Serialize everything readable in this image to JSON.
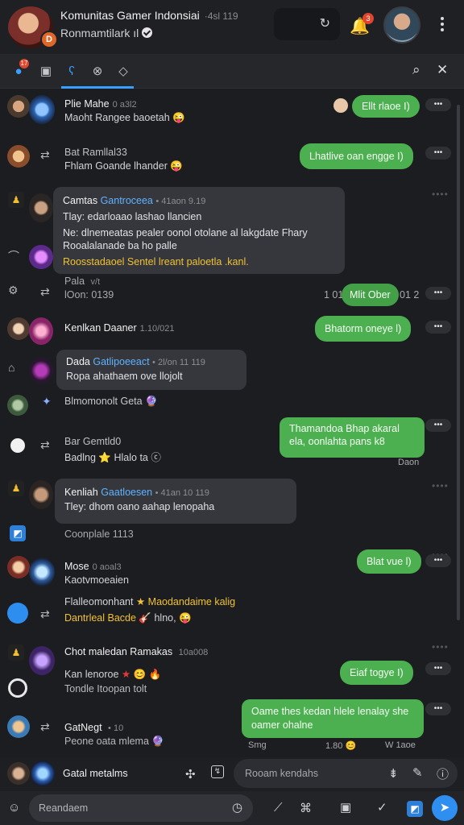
{
  "header": {
    "group_title": "Komunitas Gamer Indonsiai",
    "group_meta": "·4sl 119",
    "subtitle": "Ronmamtilark ıl",
    "group_badge": "D",
    "bell_count": "3",
    "icons": [
      "refresh-icon",
      "bell-icon",
      "kebab-menu-icon"
    ]
  },
  "tabs": {
    "items": [
      "chats-tab",
      "notes-tab",
      "mentions-tab",
      "groups-tab",
      "tags-tab"
    ],
    "badge": "17",
    "active_index": 2
  },
  "messages": [
    {
      "name": "Plie Mahe",
      "time": "0 a3l2",
      "text": "Maoht Rangee baoetah",
      "emoji": "😜",
      "reply": "Ellt rlaoe I)"
    },
    {
      "name": "Bat Ramllal33",
      "time": "",
      "text": "Fhlam Goande lhander",
      "emoji": "😜",
      "reply": "Lhatlive oan engge I)"
    },
    {
      "card": true,
      "name": "Camtas",
      "group": "Gantroceea",
      "time": "• 41aon 9.19",
      "lines": [
        "Tlay: edarloaao lashao llancien",
        "Ne: dlnemeatas pealer oonol otolane al lakgdate Fhary",
        "Rooalalanade ba ho palle"
      ],
      "highlight": "Roosstadaoel Sentel lreant paloetla .kanl."
    },
    {
      "name": "Pala",
      "time": "v/t",
      "text": "lOon: 0139",
      "reply_prefix": "1 01",
      "reply": "Mlit Ober",
      "reply_suffix": "01 2"
    },
    {
      "name": "Kenlkan Daaner",
      "time": "1.10/021",
      "reply": "Bhatorm oneye l)"
    },
    {
      "card": true,
      "name": "Dada",
      "group": "Gatlipoeeact",
      "time": "• 2l/on 11 119",
      "lines": [
        "Ropa ahathaem ove llojolt"
      ]
    },
    {
      "name": "",
      "time": "",
      "text": "Blmomonolt Geta",
      "emoji": "🔮",
      "reply": ""
    },
    {
      "name": "Bar Gemtld0",
      "time": "",
      "text": "Badlng",
      "emoji2": "Hlalo ta",
      "reply": "Thamandoa Bhap akaral ela, oonlahta pans",
      "reply_end": "k8",
      "reply_meta": "Daon"
    },
    {
      "card": true,
      "name": "Kenliah",
      "group": "Gaatloesen",
      "time": "• 41an 10 119",
      "lines": [
        "Tley: dhom oano aahap lenopaha"
      ]
    },
    {
      "name": "",
      "time": "",
      "text": "Coonplale 1113",
      "reply": ""
    },
    {
      "name": "Mose",
      "time": "0 aoal3",
      "text": "Kaotvmoeaien",
      "reply": "Blat vue l)"
    },
    {
      "name": "",
      "time": "",
      "text": "Flalleomonhant",
      "text_yellow": "Maodandaime kalig",
      "line2_yellow": "Dantrleal Bacde",
      "line2_tail": "hlno,",
      "reply": ""
    },
    {
      "name": "Chot maledan Ramakas",
      "time": "10a008",
      "text": "Kan lenoroe",
      "text2": "Tondle Itoopan tolt",
      "reply": "Eiaf togye I)"
    },
    {
      "name": "GatNegt",
      "time": "• 10",
      "text": "Peone oata mlema",
      "reply": "Oame thes kedan hlele lenalay she oamer ohalne",
      "reply_left_meta": "Smg",
      "reply_mid_meta": "1.80",
      "reply_right_meta": "W 1aoe"
    }
  ],
  "composer": {
    "channel_name": "Gatal metalms",
    "reply_placeholder": "Rooam kendahs",
    "message_placeholder": "Reandaem"
  },
  "colors": {
    "accent": "#3aa0ff",
    "bubble_green": "#4caf50",
    "background": "#1c1d20"
  }
}
